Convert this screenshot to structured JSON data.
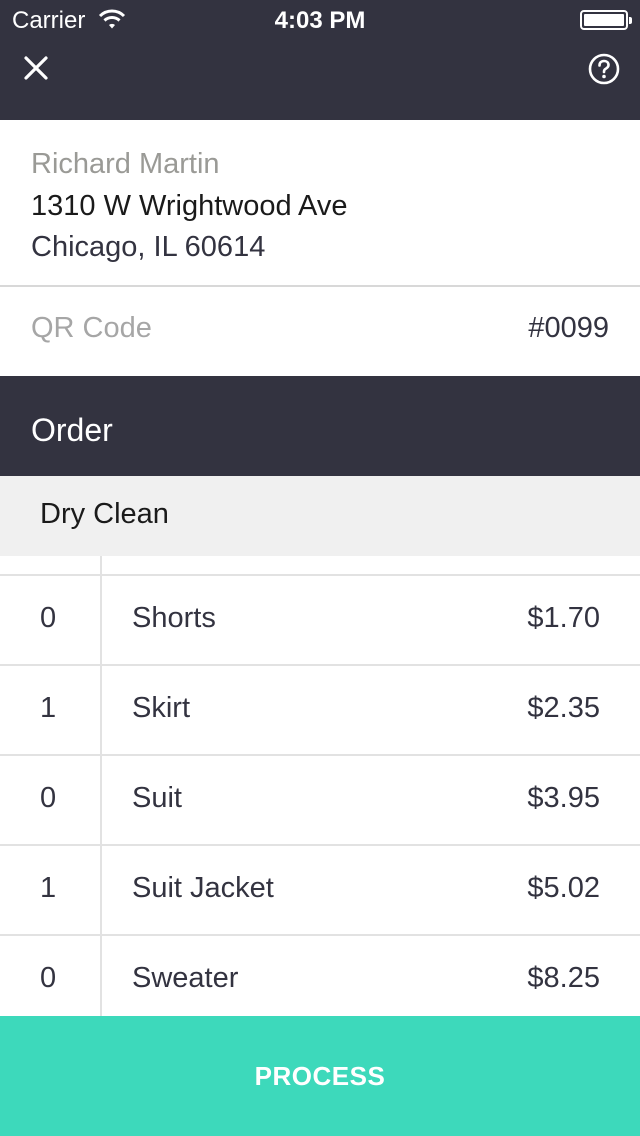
{
  "status_bar": {
    "carrier": "Carrier",
    "time": "4:03 PM"
  },
  "nav": {
    "close_icon": "close-icon",
    "help_icon": "help-icon"
  },
  "customer": {
    "name": "Richard Martin",
    "street": "1310 W Wrightwood Ave",
    "city": "Chicago, IL 60614"
  },
  "qr": {
    "label": "QR Code",
    "value": "#0099"
  },
  "order": {
    "title": "Order",
    "category": "Dry Clean",
    "items": [
      {
        "qty": "0",
        "name": "Shorts",
        "price": "$1.70"
      },
      {
        "qty": "1",
        "name": "Skirt",
        "price": "$2.35"
      },
      {
        "qty": "0",
        "name": "Suit",
        "price": "$3.95"
      },
      {
        "qty": "1",
        "name": "Suit Jacket",
        "price": "$5.02"
      },
      {
        "qty": "0",
        "name": "Sweater",
        "price": "$8.25"
      }
    ]
  },
  "actions": {
    "process_label": "PROCESS"
  },
  "colors": {
    "header_bg": "#333340",
    "accent": "#3dd9bb",
    "category_bg": "#f0f0f0",
    "muted_text": "#9a9a96"
  }
}
